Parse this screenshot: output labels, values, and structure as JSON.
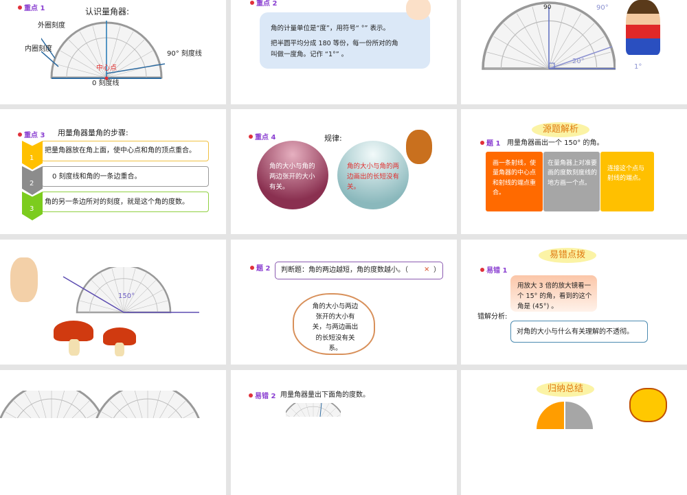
{
  "slide1": {
    "tag": "重点 1",
    "title": "认识量角器:",
    "outer": "外圈刻度",
    "inner": "内圈刻度",
    "deg90": "90° 刻度线",
    "center": "中心点",
    "zero": "0 刻度线"
  },
  "slide2": {
    "tag": "重点 2",
    "line1": "角的计量单位是“度”，用符号“ °” 表示。",
    "line2": "把半圆平均分成 180 等份，每一份所对的角",
    "line3": "叫做一度角。记作 “1°” 。"
  },
  "slide3": {
    "deg90": "90",
    "label90": "90°",
    "label20": "20°",
    "label1": "1°"
  },
  "slide4": {
    "tag": "重点 3",
    "title": "用量角器量角的步骤:",
    "steps": [
      {
        "n": "1",
        "text": "把量角器放在角上面，使中心点和角的顶点重合。"
      },
      {
        "n": "2",
        "text": "0 刻度线和角的一条边重合。"
      },
      {
        "n": "3",
        "text": "角的另一条边所对的刻度，就是这个角的度数。"
      }
    ]
  },
  "slide5": {
    "tag": "重点 4",
    "title": "规律:",
    "ball1": "角的大小与角的两边张开的大小有关。",
    "ball2": "角的大小与角的两边画出的长短没有关。"
  },
  "slide6": {
    "banner": "源题解析",
    "tag": "题 1",
    "question": "用量角器画出一个 150° 的角。",
    "box1": "画一条射线，使量角器的中心点和射线的端点重合。",
    "box2": "在量角器上对准要画的度数刻度线的地方画一个点。",
    "box3": "连接这个点与射线的端点。"
  },
  "slide7": {
    "label": "150°"
  },
  "slide8": {
    "tag": "题 2",
    "question": "判断题：角的两边越短，角的度数越小。（",
    "mark": "×",
    "close": "）",
    "cloud": "角的大小与两边张开的大小有关，与两边画出的长短没有关系。"
  },
  "slide9": {
    "banner": "易错点拨",
    "tag": "易错 1",
    "question": "用放大 3 倍的放大镜看一个 15° 的角，看到的这个角是 (45°) 。",
    "analysis_label": "错解分析:",
    "analysis": "对角的大小与什么有关理解的不透彻。"
  },
  "slide11": {
    "tag": "易错 2",
    "question": "用量角器量出下面角的度数。"
  },
  "slide12": {
    "banner": "归纳总结"
  },
  "colors": {
    "purple": "#8a3fd1",
    "orange": "#ff6a00",
    "gray": "#a6a6a6",
    "yellow": "#ffc000",
    "green": "#7ccc1e"
  }
}
